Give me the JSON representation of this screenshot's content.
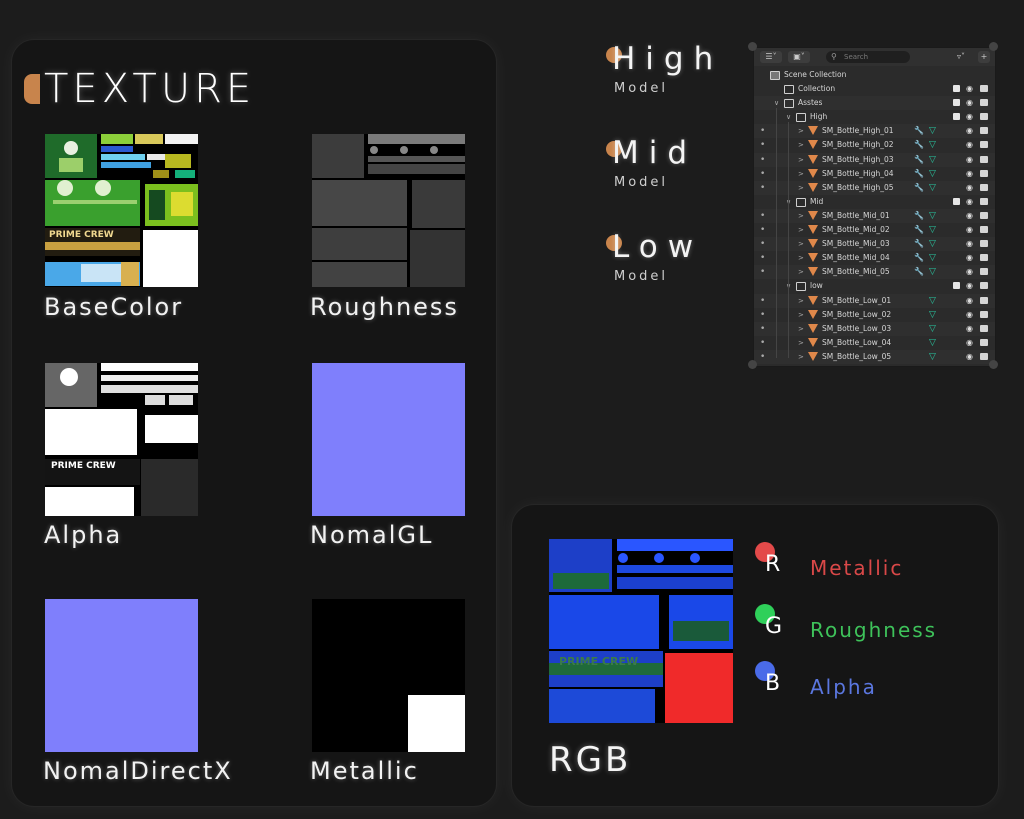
{
  "texture_panel": {
    "title": "TEXTURE",
    "maps": [
      {
        "label": "BaseColor"
      },
      {
        "label": "Roughness"
      },
      {
        "label": "Alpha"
      },
      {
        "label": "NomalGL"
      },
      {
        "label": "NomalDirectX"
      },
      {
        "label": "Metallic"
      }
    ],
    "label_texts": {
      "basecolor": "PRIME CREW",
      "alpha": "PRIME CREW"
    }
  },
  "lods": [
    {
      "name": "High",
      "sub": "Model"
    },
    {
      "name": "Mid",
      "sub": "Model"
    },
    {
      "name": "Low",
      "sub": "Model"
    }
  ],
  "outliner": {
    "search_placeholder": "Search",
    "scene_collection": "Scene Collection",
    "rows": [
      {
        "name": "Collection"
      },
      {
        "name": "Asstes"
      },
      {
        "name": "High"
      },
      {
        "name": "SM_Bottle_High_01"
      },
      {
        "name": "SM_Bottle_High_02"
      },
      {
        "name": "SM_Bottle_High_03"
      },
      {
        "name": "SM_Bottle_High_04"
      },
      {
        "name": "SM_Bottle_High_05"
      },
      {
        "name": "Mid"
      },
      {
        "name": "SM_Bottle_Mid_01"
      },
      {
        "name": "SM_Bottle_Mid_02"
      },
      {
        "name": "SM_Bottle_Mid_03"
      },
      {
        "name": "SM_Bottle_Mid_04"
      },
      {
        "name": "SM_Bottle_Mid_05"
      },
      {
        "name": "low"
      },
      {
        "name": "SM_Bottle_Low_01"
      },
      {
        "name": "SM_Bottle_Low_02"
      },
      {
        "name": "SM_Bottle_Low_03"
      },
      {
        "name": "SM_Bottle_Low_04"
      },
      {
        "name": "SM_Bottle_Low_05"
      }
    ]
  },
  "rgb_panel": {
    "title": "RGB",
    "label_text": "PRIME CREW",
    "channels": [
      {
        "letter": "R",
        "name": "Metallic",
        "color": "#e34a4a",
        "text_color": "#d94848"
      },
      {
        "letter": "G",
        "name": "Roughness",
        "color": "#2fd05a",
        "text_color": "#3ec25a"
      },
      {
        "letter": "B",
        "name": "Alpha",
        "color": "#4a6be8",
        "text_color": "#5b77e0"
      }
    ]
  },
  "colors": {
    "accent": "#c8844c",
    "normal_map": "#7f7ffc"
  }
}
